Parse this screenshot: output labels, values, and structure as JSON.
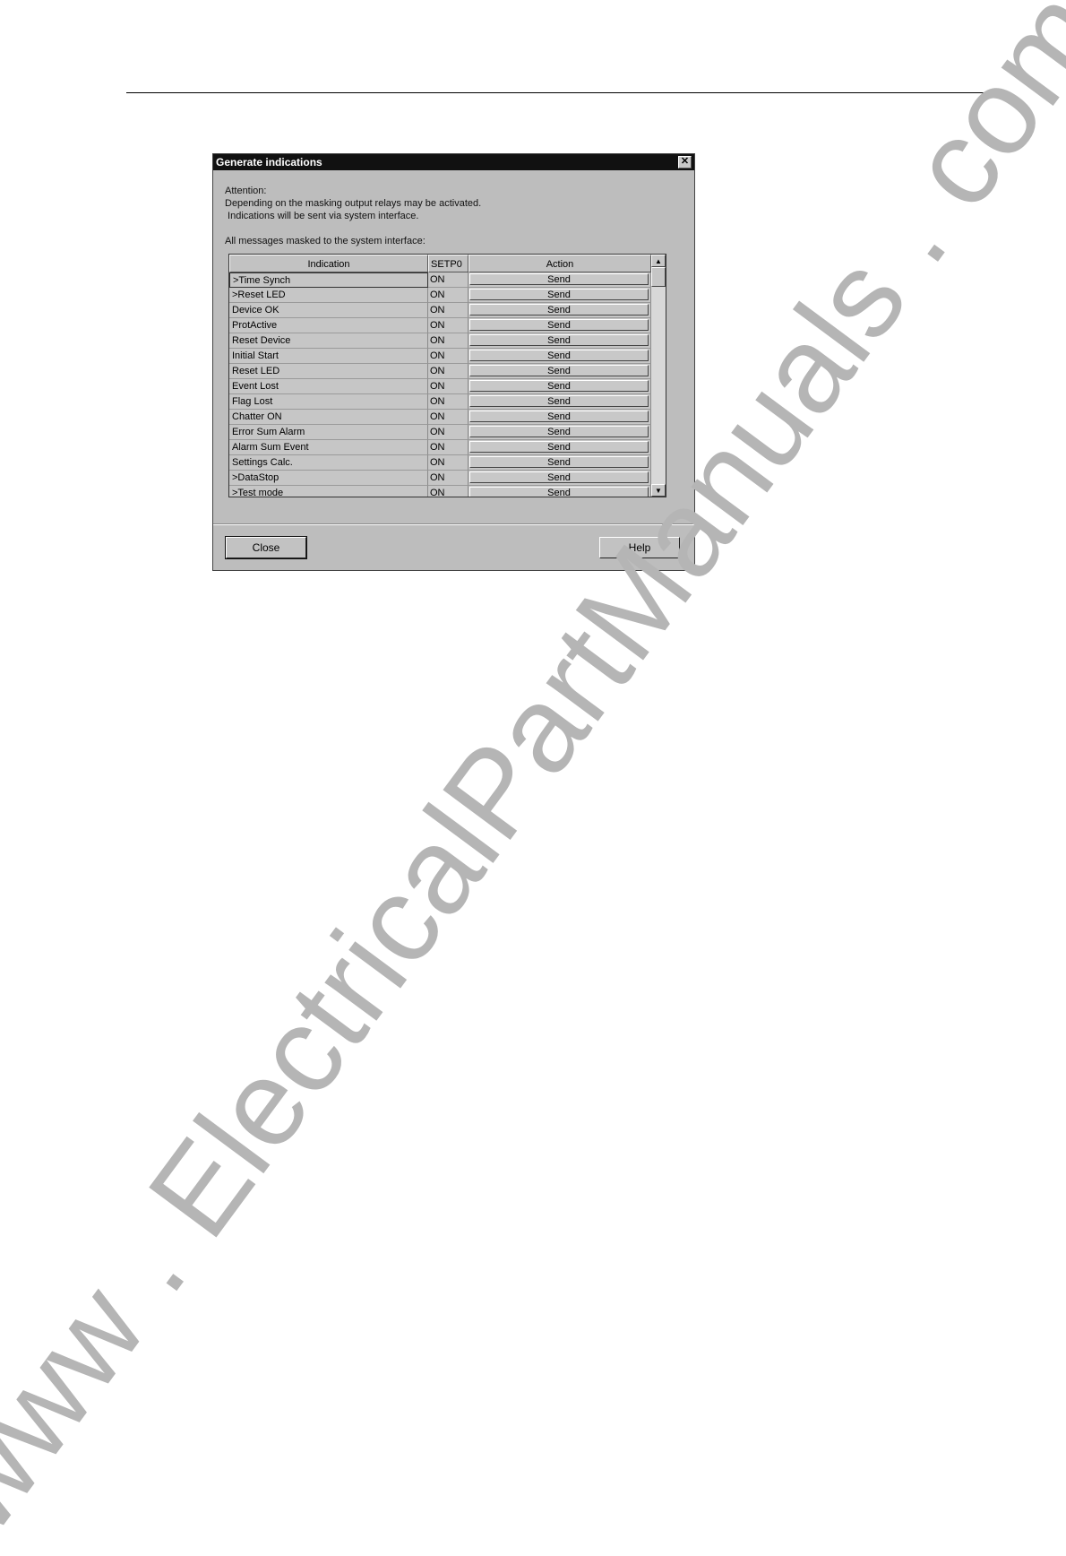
{
  "dialog": {
    "title": "Generate indications",
    "close_glyph": "✕",
    "attention": "Attention:",
    "line1": "Depending on the masking output relays may be activated.",
    "line2": " Indications will be sent via system interface.",
    "masked_label": "All messages masked to the system interface:"
  },
  "table": {
    "headers": [
      "Indication",
      "SETP0",
      "Action"
    ],
    "rows": [
      {
        "indication": ">Time Synch",
        "setp": "ON",
        "action": "Send"
      },
      {
        "indication": ">Reset LED",
        "setp": "ON",
        "action": "Send"
      },
      {
        "indication": "Device OK",
        "setp": "ON",
        "action": "Send"
      },
      {
        "indication": "ProtActive",
        "setp": "ON",
        "action": "Send"
      },
      {
        "indication": "Reset Device",
        "setp": "ON",
        "action": "Send"
      },
      {
        "indication": "Initial Start",
        "setp": "ON",
        "action": "Send"
      },
      {
        "indication": "Reset LED",
        "setp": "ON",
        "action": "Send"
      },
      {
        "indication": "Event Lost",
        "setp": "ON",
        "action": "Send"
      },
      {
        "indication": "Flag Lost",
        "setp": "ON",
        "action": "Send"
      },
      {
        "indication": "Chatter ON",
        "setp": "ON",
        "action": "Send"
      },
      {
        "indication": "Error Sum Alarm",
        "setp": "ON",
        "action": "Send"
      },
      {
        "indication": "Alarm Sum Event",
        "setp": "ON",
        "action": "Send"
      },
      {
        "indication": "Settings Calc.",
        "setp": "ON",
        "action": "Send"
      },
      {
        "indication": ">DataStop",
        "setp": "ON",
        "action": "Send"
      },
      {
        "indication": ">Test mode",
        "setp": "ON",
        "action": "Send"
      }
    ]
  },
  "buttons": {
    "close": "Close",
    "help": "Help"
  },
  "watermark": "www . ElectricalPartManuals . com"
}
